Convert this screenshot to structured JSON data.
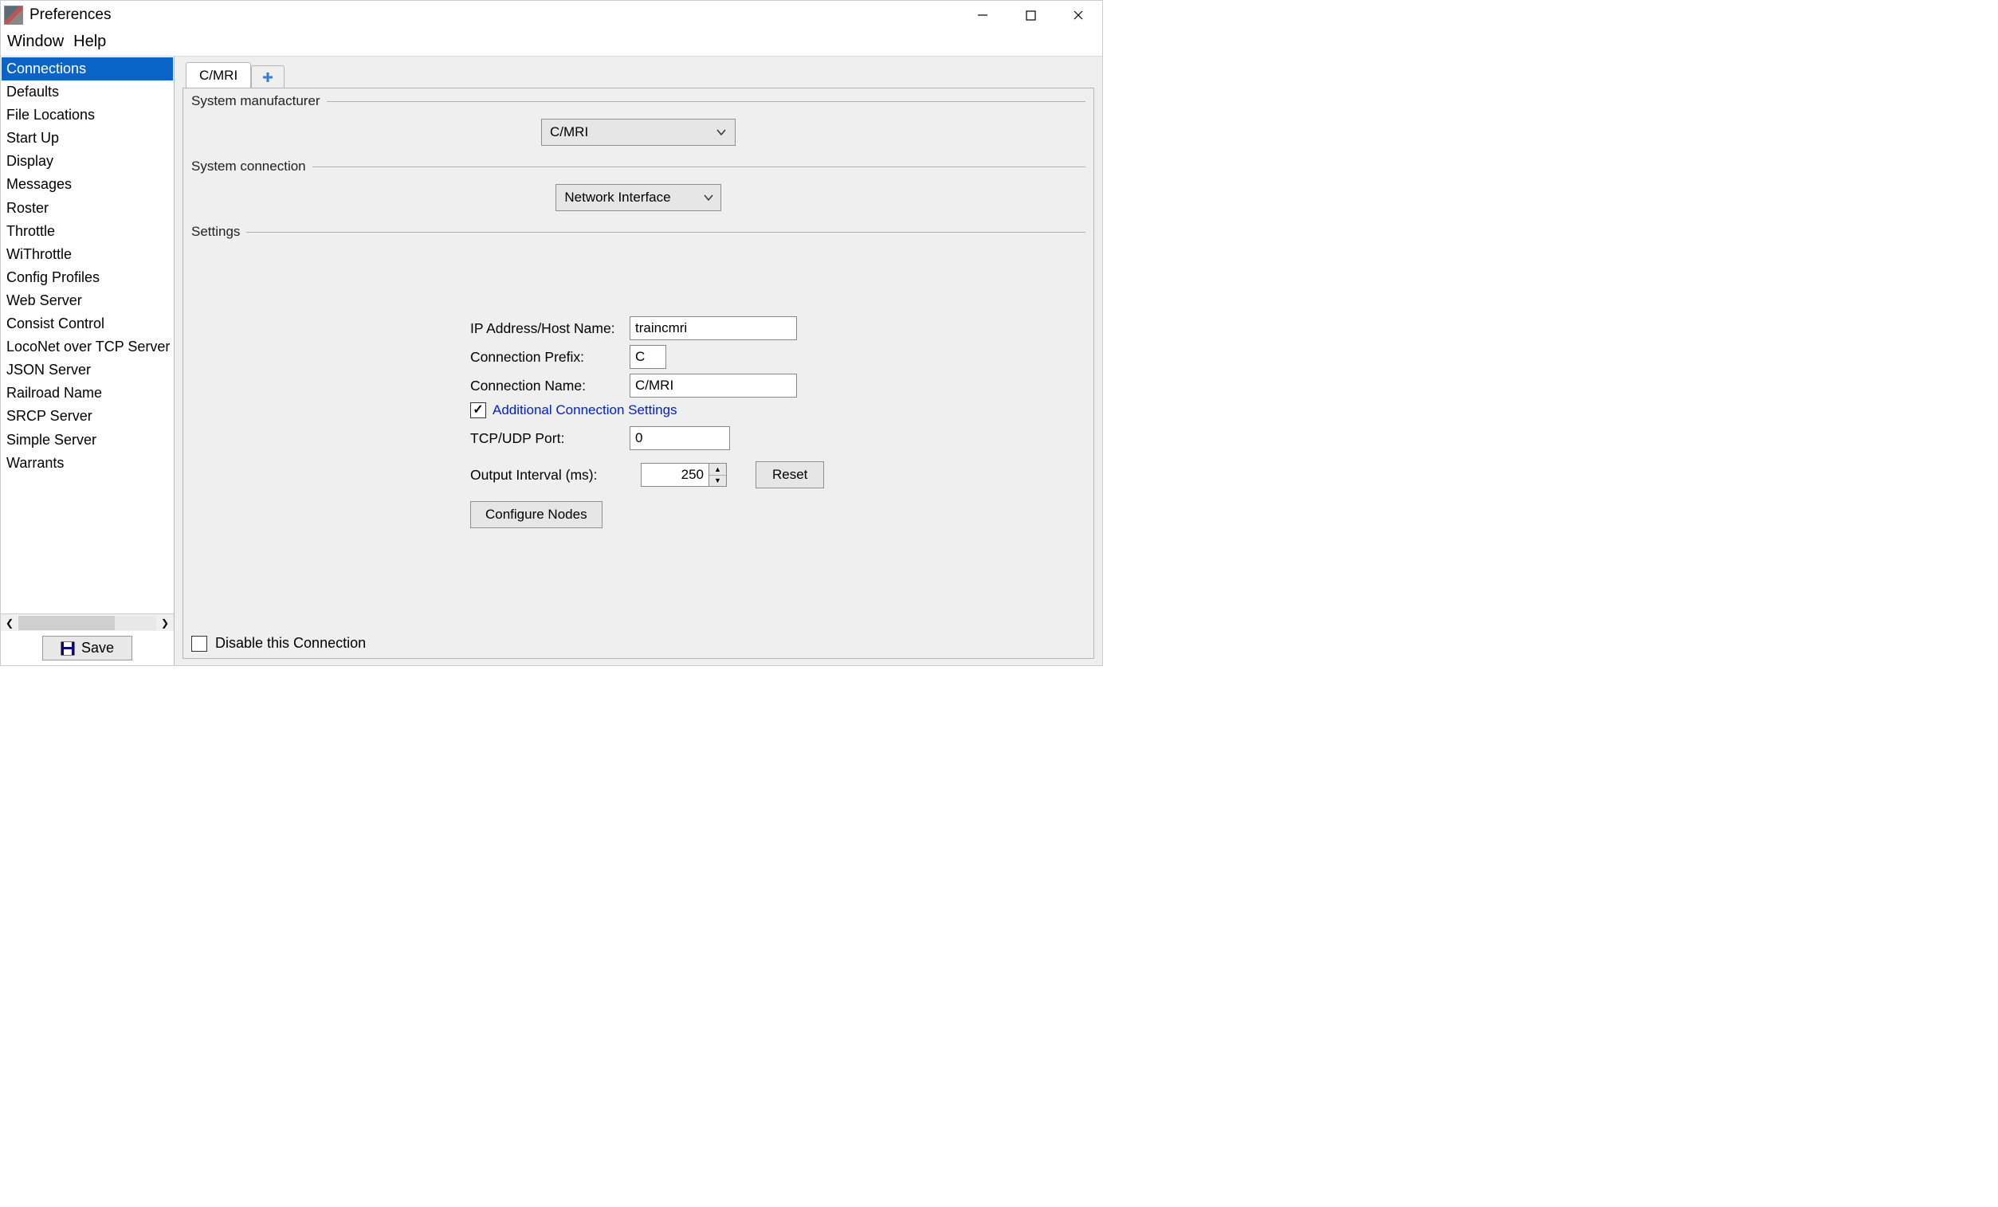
{
  "title": "Preferences",
  "menubar": {
    "window": "Window",
    "help": "Help"
  },
  "sidebar": {
    "items": [
      "Connections",
      "Defaults",
      "File Locations",
      "Start Up",
      "Display",
      "Messages",
      "Roster",
      "Throttle",
      "WiThrottle",
      "Config Profiles",
      "Web Server",
      "Consist Control",
      "LocoNet over TCP Server",
      "JSON Server",
      "Railroad Name",
      "SRCP Server",
      "Simple Server",
      "Warrants"
    ],
    "selected_index": 0,
    "save_label": "Save"
  },
  "tabs": {
    "active": "C/MRI"
  },
  "groups": {
    "manufacturer": {
      "label": "System manufacturer",
      "value": "C/MRI"
    },
    "connection": {
      "label": "System connection",
      "value": "Network Interface"
    },
    "settings": {
      "label": "Settings"
    }
  },
  "form": {
    "ip_label": "IP Address/Host Name:",
    "ip_value": "traincmri",
    "prefix_label": "Connection Prefix:",
    "prefix_value": "C",
    "name_label": "Connection Name:",
    "name_value": "C/MRI",
    "additional_label": "Additional Connection Settings",
    "additional_checked": true,
    "port_label": "TCP/UDP Port:",
    "port_value": "0",
    "interval_label": "Output Interval (ms):",
    "interval_value": "250",
    "reset_label": "Reset",
    "configure_nodes_label": "Configure Nodes"
  },
  "footer": {
    "disable_label": "Disable this Connection",
    "disable_checked": false
  }
}
